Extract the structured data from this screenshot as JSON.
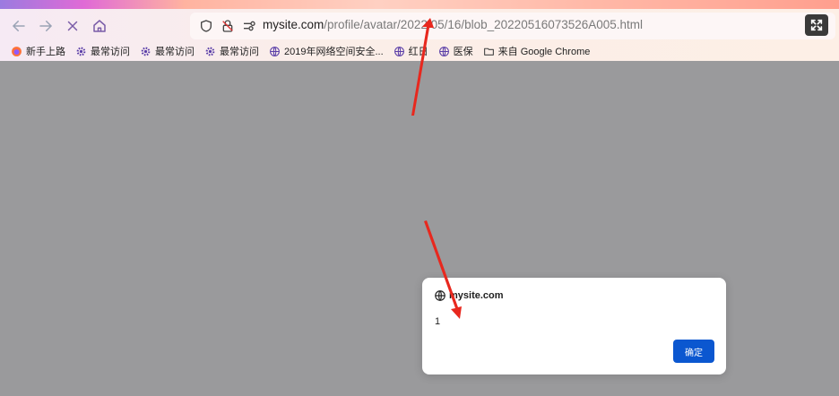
{
  "toolbar": {
    "back_icon": "arrow-left-icon",
    "forward_icon": "arrow-right-icon",
    "stop_icon": "close-icon",
    "home_icon": "home-icon"
  },
  "url": {
    "host": "mysite.com",
    "path": "/profile/avatar/2022/05/16/blob_20220516073526A005.html"
  },
  "bookmarks": [
    {
      "label": "新手上路",
      "icon": "firefox-icon"
    },
    {
      "label": "最常访问",
      "icon": "gear-icon"
    },
    {
      "label": "最常访问",
      "icon": "gear-icon"
    },
    {
      "label": "最常访问",
      "icon": "gear-icon"
    },
    {
      "label": "2019年网络空间安全...",
      "icon": "globe-icon"
    },
    {
      "label": "红日",
      "icon": "globe-icon"
    },
    {
      "label": "医保",
      "icon": "globe-icon"
    },
    {
      "label": "来自 Google Chrome",
      "icon": "folder-icon"
    }
  ],
  "dialog": {
    "title": "mysite.com",
    "message": "1",
    "ok_label": "确定"
  },
  "colors": {
    "page_overlay": "#9a9a9c",
    "button_blue": "#0b57d0",
    "annotation_red": "#e8281e"
  }
}
